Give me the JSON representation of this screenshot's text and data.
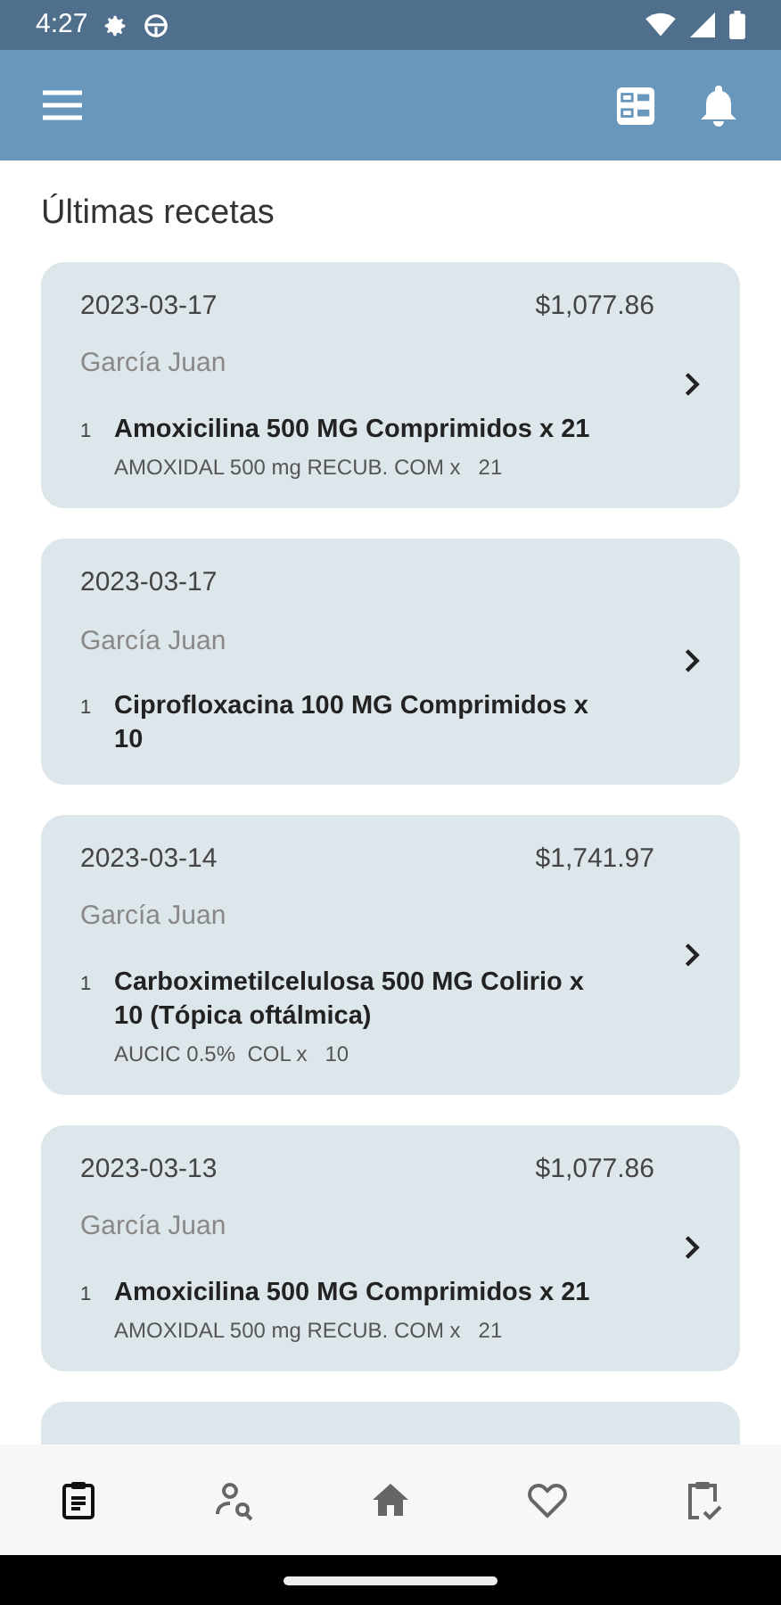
{
  "status_bar": {
    "time": "4:27"
  },
  "section_title": "Últimas recetas",
  "prescriptions": [
    {
      "date": "2023-03-17",
      "total": "$1,077.86",
      "patient": "García Juan",
      "items": [
        {
          "qty": "1",
          "name": "Amoxicilina 500 MG Comprimidos x 21",
          "detail": "AMOXIDAL 500 mg RECUB. COM x   21"
        }
      ]
    },
    {
      "date": "2023-03-17",
      "patient": "García Juan",
      "items": [
        {
          "qty": "1",
          "name": "Ciprofloxacina 100 MG Comprimidos x 10"
        }
      ]
    },
    {
      "date": "2023-03-14",
      "total": "$1,741.97",
      "patient": "García Juan",
      "items": [
        {
          "qty": "1",
          "name": "Carboximetilcelulosa 500 MG Colirio x 10 (Tópica oftálmica)",
          "detail": "AUCIC 0.5%  COL x   10"
        }
      ]
    },
    {
      "date": "2023-03-13",
      "total": "$1,077.86",
      "patient": "García Juan",
      "items": [
        {
          "qty": "1",
          "name": "Amoxicilina 500 MG Comprimidos x 21",
          "detail": "AMOXIDAL 500 mg RECUB. COM x   21"
        }
      ]
    }
  ],
  "next_card_cut_off": true,
  "bottom_nav": [
    {
      "kind": "prescriptions",
      "selected": true
    },
    {
      "kind": "search-person",
      "selected": false
    },
    {
      "kind": "home",
      "selected": false
    },
    {
      "kind": "favorites",
      "selected": false
    },
    {
      "kind": "checklist",
      "selected": false
    }
  ]
}
